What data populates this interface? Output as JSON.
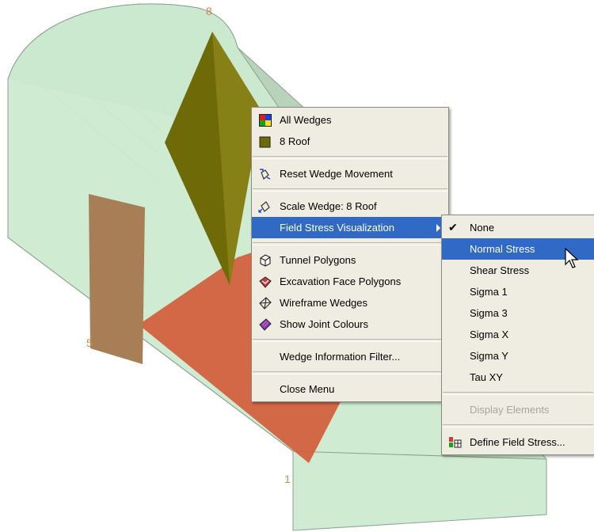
{
  "scene": {
    "wedge_labels": [
      "8",
      "5",
      "1"
    ]
  },
  "context_menu": {
    "items": [
      {
        "label": "All Wedges",
        "icon": "all-wedges-icon"
      },
      {
        "label": "8  Roof",
        "icon": "roof-color-swatch-icon"
      },
      {
        "label": "Reset Wedge Movement",
        "icon": "reset-wedge-icon"
      },
      {
        "label": "Scale Wedge: 8  Roof",
        "icon": "scale-wedge-icon"
      },
      {
        "label": "Field Stress Visualization",
        "icon": "submenu-arrow-icon",
        "highlighted": true
      },
      {
        "label": "Tunnel Polygons",
        "icon": "tunnel-polygon-icon"
      },
      {
        "label": "Excavation Face Polygons",
        "icon": "excavation-face-icon"
      },
      {
        "label": "Wireframe Wedges",
        "icon": "wireframe-wedge-icon"
      },
      {
        "label": "Show Joint Colours",
        "icon": "joint-colours-icon"
      },
      {
        "label": "Wedge Information Filter...",
        "icon": ""
      },
      {
        "label": "Close Menu",
        "icon": "",
        "underline": "C"
      }
    ]
  },
  "submenu": {
    "items": [
      {
        "label": "None",
        "checked": true
      },
      {
        "label": "Normal Stress",
        "highlighted": true
      },
      {
        "label": "Shear Stress"
      },
      {
        "label": "Sigma 1"
      },
      {
        "label": "Sigma 3"
      },
      {
        "label": "Sigma X"
      },
      {
        "label": "Sigma Y"
      },
      {
        "label": "Tau XY"
      },
      {
        "label": "Display Elements",
        "disabled": true
      },
      {
        "label": "Define Field Stress...",
        "icon": "define-field-stress-icon"
      }
    ]
  },
  "colors": {
    "menu_bg": "#efede2",
    "highlight": "#316ac5",
    "tunnel_fill": "#cdebd0",
    "roof_wedge": "#6f6a08",
    "floor_wedge": "#d25a36",
    "side_wedge": "#a77e55"
  }
}
